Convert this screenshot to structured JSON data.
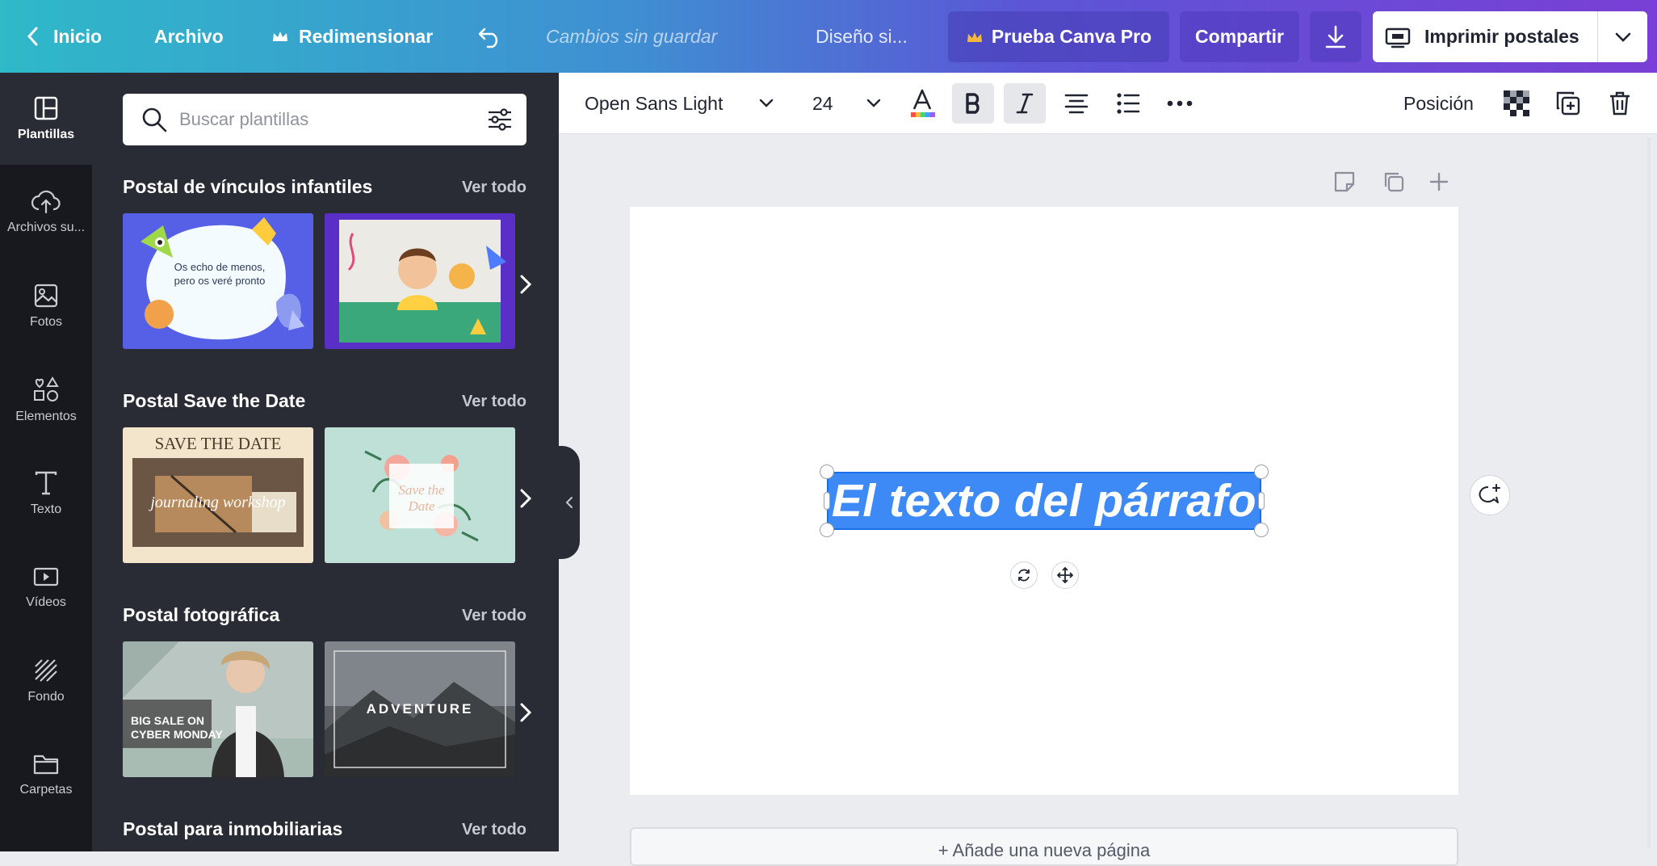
{
  "topbar": {
    "home_label": "Inicio",
    "file_label": "Archivo",
    "resize_label": "Redimensionar",
    "unsaved_label": "Cambios sin guardar",
    "design_name": "Diseño si...",
    "pro_label": "Prueba Canva Pro",
    "share_label": "Compartir",
    "print_label": "Imprimir postales"
  },
  "rail": {
    "items": [
      {
        "label": "Plantillas",
        "icon": "templates-icon"
      },
      {
        "label": "Archivos su...",
        "icon": "upload-icon"
      },
      {
        "label": "Fotos",
        "icon": "photos-icon"
      },
      {
        "label": "Elementos",
        "icon": "elements-icon"
      },
      {
        "label": "Texto",
        "icon": "text-icon"
      },
      {
        "label": "Vídeos",
        "icon": "videos-icon"
      },
      {
        "label": "Fondo",
        "icon": "background-icon"
      },
      {
        "label": "Carpetas",
        "icon": "folders-icon"
      }
    ]
  },
  "panel": {
    "search_placeholder": "Buscar plantillas",
    "sections": [
      {
        "title": "Postal de vínculos infantiles",
        "link": "Ver todo",
        "thumbs": [
          {
            "text": "Os echo de menos, pero os veré pronto"
          },
          {
            "text": ""
          }
        ]
      },
      {
        "title": "Postal Save the Date",
        "link": "Ver todo",
        "thumbs": [
          {
            "text": "SAVE THE DATE",
            "sub": "journaling workshop"
          },
          {
            "text": "Save the Date"
          }
        ]
      },
      {
        "title": "Postal fotográfica",
        "link": "Ver todo",
        "thumbs": [
          {
            "text": "BIG SALE ON CYBER MONDAY"
          },
          {
            "text": "ADVENTURE"
          }
        ]
      },
      {
        "title": "Postal para inmobiliarias",
        "link": "Ver todo"
      }
    ]
  },
  "toolbar": {
    "font_name": "Open Sans Light",
    "font_size": "24",
    "position_label": "Posición"
  },
  "canvas": {
    "selected_text": "El texto del párrafo",
    "add_page_label": "+ Añade una nueva página"
  },
  "colors": {
    "accent": "#3d8af7",
    "panel_bg": "#2a2c35",
    "rail_bg": "#18191f"
  }
}
